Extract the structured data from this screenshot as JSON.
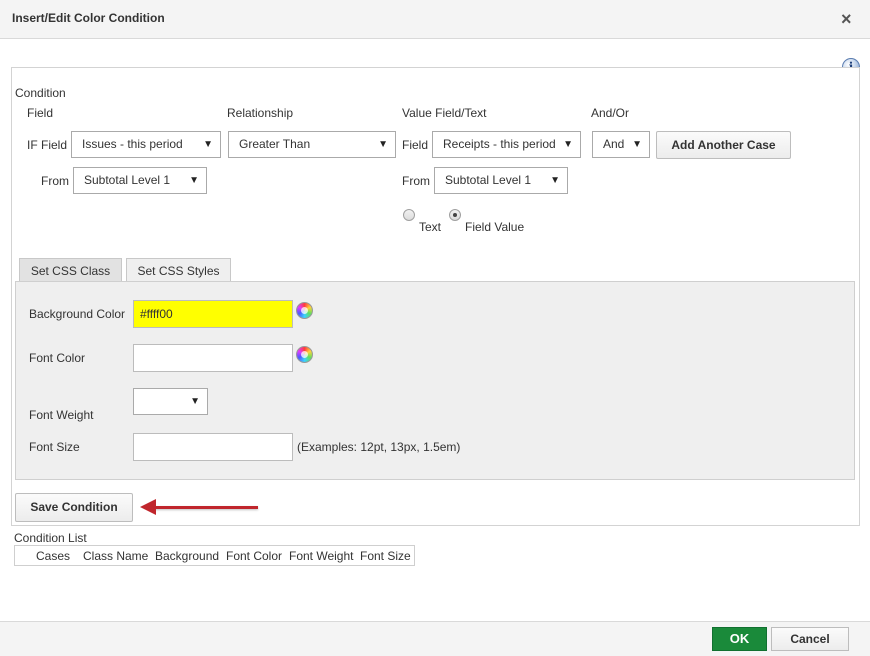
{
  "dialog": {
    "title": "Insert/Edit Color Condition",
    "close_symbol": "×",
    "info_symbol": "i"
  },
  "condition": {
    "section_label": "Condition",
    "headers": {
      "field": "Field",
      "relationship": "Relationship",
      "value_field": "Value Field/Text",
      "and_or": "And/Or"
    },
    "if_field_label": "IF Field",
    "if_field_value": "Issues - this period",
    "from_label": "From",
    "from_value": "Subtotal Level 1",
    "relationship_value": "Greater Than",
    "value_field_label": "Field",
    "value_field_value": "Receipts - this period",
    "value_from_label": "From",
    "value_from_value": "Subtotal Level 1",
    "and_or_value": "And",
    "add_case_label": "Add Another Case",
    "radio_text_label": "Text",
    "radio_field_value_label": "Field Value",
    "selected_radio": "Field Value"
  },
  "tabs": [
    {
      "label": "Set CSS Class",
      "active": false
    },
    {
      "label": "Set CSS Styles",
      "active": true
    }
  ],
  "styles": {
    "background_color_label": "Background Color",
    "background_color_value": "#ffff00",
    "font_color_label": "Font Color",
    "font_color_value": "",
    "font_weight_label": "Font Weight",
    "font_weight_value": "",
    "font_size_label": "Font Size",
    "font_size_value": "",
    "font_size_hint": "(Examples: 12pt, 13px, 1.5em)"
  },
  "save_condition_label": "Save Condition",
  "condition_list": {
    "label": "Condition List",
    "columns": [
      "Cases",
      "Class Name",
      "Background",
      "Font Color",
      "Font Weight",
      "Font Size"
    ]
  },
  "footer": {
    "ok_label": "OK",
    "cancel_label": "Cancel"
  },
  "colors": {
    "ok_green": "#1a8a3a",
    "highlight_yellow": "#ffff00",
    "annotation_arrow": "#c0262c"
  },
  "icons": {
    "close": "close-icon",
    "info": "info-icon",
    "color_picker": "color-wheel-icon",
    "dropdown": "chevron-down-icon"
  }
}
